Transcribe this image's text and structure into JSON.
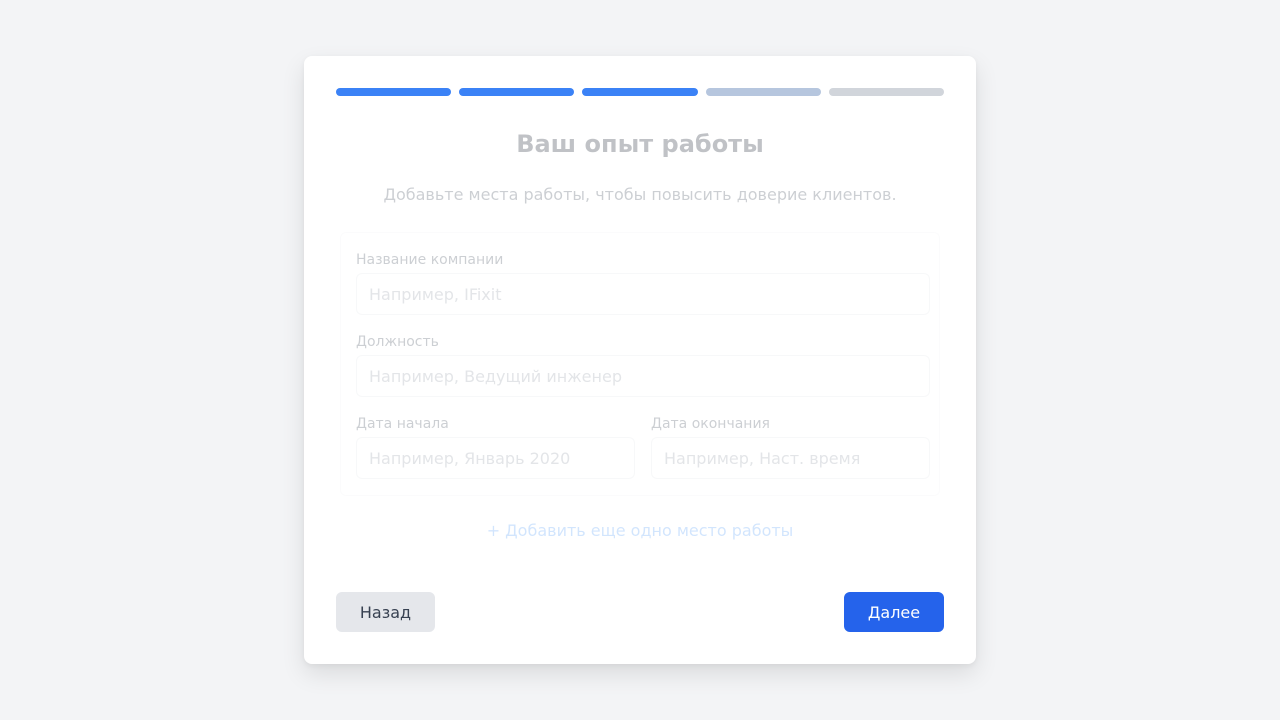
{
  "progress": {
    "total_steps": 5,
    "completed_steps": 3,
    "current_step": 4
  },
  "header": {
    "title": "Ваш опыт работы",
    "subtitle": "Добавьте места работы, чтобы повысить доверие клиентов."
  },
  "form": {
    "company": {
      "label": "Название компании",
      "placeholder": "Например, IFixit",
      "value": ""
    },
    "position": {
      "label": "Должность",
      "placeholder": "Например, Ведущий инженер",
      "value": ""
    },
    "start_date": {
      "label": "Дата начала",
      "placeholder": "Например, Январь 2020",
      "value": ""
    },
    "end_date": {
      "label": "Дата окончания",
      "placeholder": "Например, Наст. время",
      "value": ""
    },
    "add_more_label": "+ Добавить еще одно место работы"
  },
  "footer": {
    "back_label": "Назад",
    "next_label": "Далее"
  },
  "colors": {
    "accent": "#2563eb",
    "progress_done": "#3b82f6",
    "progress_current": "#b6c6de",
    "progress_todo": "#d1d5db",
    "background": "#f3f4f6"
  }
}
